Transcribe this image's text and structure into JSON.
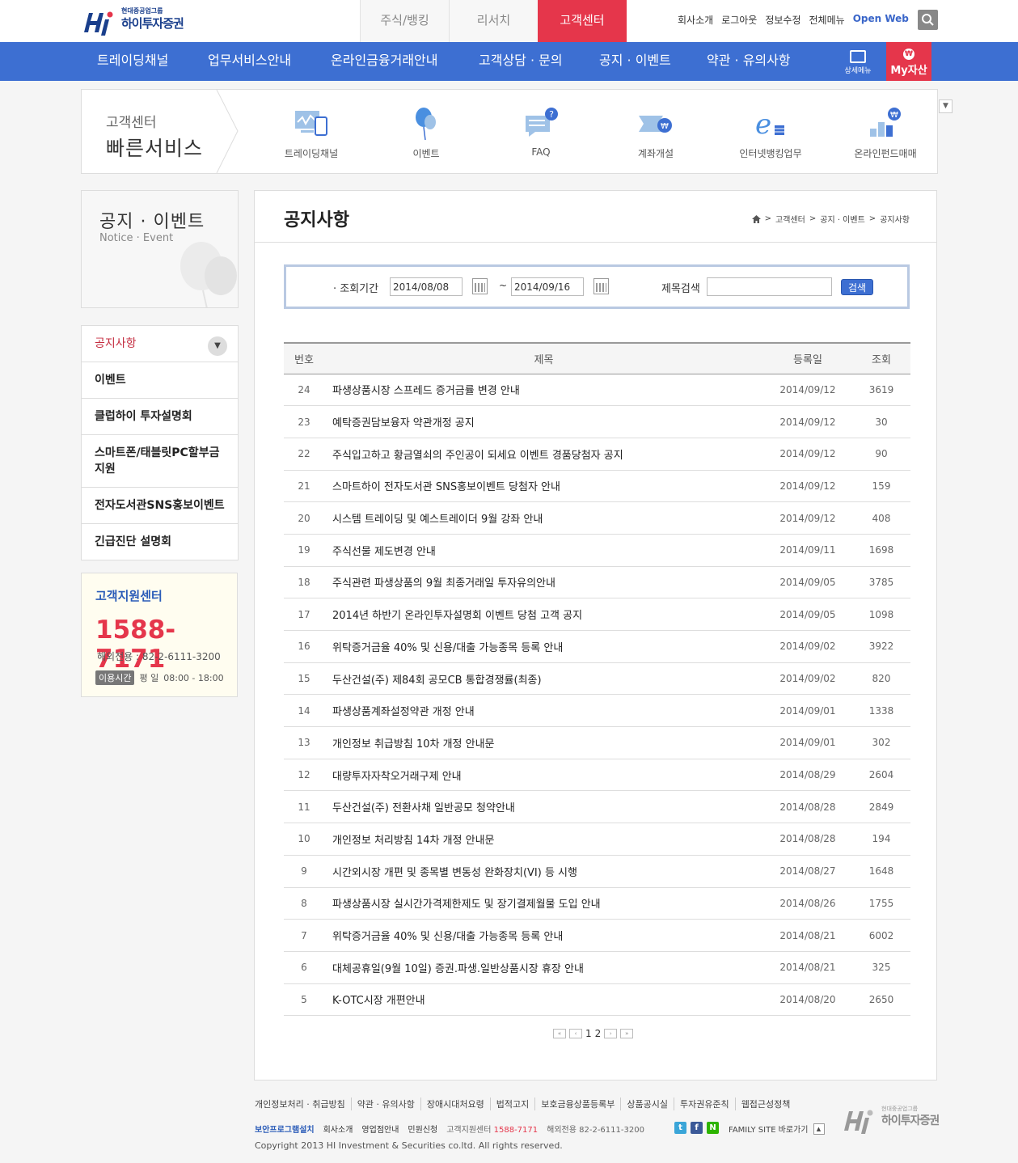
{
  "brand": {
    "group": "현대중공업그룹",
    "name": "하이투자증권"
  },
  "top_tabs": [
    {
      "label": "주식/뱅킹"
    },
    {
      "label": "리서치"
    },
    {
      "label": "고객센터"
    }
  ],
  "utility_links": [
    "회사소개",
    "로그아웃",
    "정보수정",
    "전체메뉴",
    "Open Web"
  ],
  "gnb": {
    "items": [
      "트레이딩채널",
      "업무서비스안내",
      "온라인금융거래안내",
      "고객상담 · 문의",
      "공지 · 이벤트",
      "약관 · 유의사항"
    ],
    "detail_label": "상세메뉴",
    "my_asset_label": "My자산"
  },
  "quick": {
    "small_title": "고객센터",
    "big_title": "빠른서비스",
    "items": [
      "트레이딩채널",
      "이벤트",
      "FAQ",
      "계좌개설",
      "인터넷뱅킹업무",
      "온라인펀드매매"
    ]
  },
  "side": {
    "title_ko": "공지 · 이벤트",
    "title_en": "Notice · Event",
    "menu": [
      "공지사항",
      "이벤트",
      "클럽하이 투자설명회",
      "스마트폰/태블릿PC할부금지원",
      "전자도서관SNS홍보이벤트",
      "긴급진단 설명회"
    ]
  },
  "support": {
    "title": "고객지원센터",
    "phone": "1588-7171",
    "intl": "해외전용 : 82-2-6111-3200",
    "hours_badge": "이용시간",
    "hours_days": "평  일",
    "hours": "08:00 - 18:00"
  },
  "main": {
    "title": "공지사항",
    "breadcrumb": [
      "고객센터",
      "공지 · 이벤트",
      "공지사항"
    ]
  },
  "filter": {
    "period_label": "· 조회기간",
    "start_date": "2014/08/08",
    "separator": "~",
    "end_date": "2014/09/16",
    "title_search_label": "제목검색",
    "title_search_value": "",
    "search_button": "검색"
  },
  "table": {
    "headers": [
      "번호",
      "제목",
      "등록일",
      "조회"
    ],
    "rows": [
      {
        "no": "24",
        "title": "파생상품시장 스프레드 증거금률 변경 안내",
        "date": "2014/09/12",
        "views": "3619"
      },
      {
        "no": "23",
        "title": "예탁증권담보융자 약관개정 공지",
        "date": "2014/09/12",
        "views": "30"
      },
      {
        "no": "22",
        "title": "주식입고하고 황금열쇠의 주인공이 되세요 이벤트 경품당첨자 공지",
        "date": "2014/09/12",
        "views": "90"
      },
      {
        "no": "21",
        "title": "스마트하이 전자도서관 SNS홍보이벤트 당첨자 안내",
        "date": "2014/09/12",
        "views": "159"
      },
      {
        "no": "20",
        "title": "시스템 트레이딩 및 예스트레이더 9월 강좌 안내",
        "date": "2014/09/12",
        "views": "408"
      },
      {
        "no": "19",
        "title": "주식선물 제도변경 안내",
        "date": "2014/09/11",
        "views": "1698"
      },
      {
        "no": "18",
        "title": "주식관련 파생상품의 9월 최종거래일 투자유의안내",
        "date": "2014/09/05",
        "views": "3785"
      },
      {
        "no": "17",
        "title": "2014년 하반기 온라인투자설명회 이벤트 당첨 고객 공지",
        "date": "2014/09/05",
        "views": "1098"
      },
      {
        "no": "16",
        "title": "위탁증거금율 40% 및 신용/대출 가능종목 등록 안내",
        "date": "2014/09/02",
        "views": "3922"
      },
      {
        "no": "15",
        "title": "두산건설(주) 제84회 공모CB 통합경쟁률(최종)",
        "date": "2014/09/02",
        "views": "820"
      },
      {
        "no": "14",
        "title": "파생상품계좌설정약관 개정 안내",
        "date": "2014/09/01",
        "views": "1338"
      },
      {
        "no": "13",
        "title": "개인정보 취급방침 10차 개정 안내문",
        "date": "2014/09/01",
        "views": "302"
      },
      {
        "no": "12",
        "title": "대량투자자착오거래구제 안내",
        "date": "2014/08/29",
        "views": "2604"
      },
      {
        "no": "11",
        "title": "두산건설(주) 전환사채 일반공모 청약안내",
        "date": "2014/08/28",
        "views": "2849"
      },
      {
        "no": "10",
        "title": "개인정보 처리방침 14차 개정 안내문",
        "date": "2014/08/28",
        "views": "194"
      },
      {
        "no": "9",
        "title": "시간외시장 개편 및 종목별 변동성 완화장치(VI) 등 시행",
        "date": "2014/08/27",
        "views": "1648"
      },
      {
        "no": "8",
        "title": "파생상품시장 실시간가격제한제도 및 장기결제월물 도입 안내",
        "date": "2014/08/26",
        "views": "1755"
      },
      {
        "no": "7",
        "title": "위탁증거금율 40% 및 신용/대출 가능종목 등록 안내",
        "date": "2014/08/21",
        "views": "6002"
      },
      {
        "no": "6",
        "title": "대체공휴일(9월 10일) 증권.파생.일반상품시장 휴장 안내",
        "date": "2014/08/21",
        "views": "325"
      },
      {
        "no": "5",
        "title": "K-OTC시장 개편안내",
        "date": "2014/08/20",
        "views": "2650"
      }
    ]
  },
  "pager": {
    "first": "«",
    "prev": "‹",
    "pages": [
      "1",
      "2"
    ],
    "next": "›",
    "last": "»"
  },
  "footer": {
    "links": [
      "개인정보처리 · 취급방침",
      "약관 · 유의사항",
      "장애시대처요령",
      "법적고지",
      "보호금융상품등록부",
      "상품공시실",
      "투자권유준칙",
      "웹접근성정책"
    ],
    "security": "보안프로그램설치",
    "links2": [
      "회사소개",
      "영업점안내",
      "민원신청"
    ],
    "support_label": "고객지원센터",
    "support_phone": "1588-7171",
    "intl": "해외전용 82-2-6111-3200",
    "family": "FAMILY SITE 바로가기",
    "copyright": "Copyright 2013 HI Investment & Securities co.ltd. All rights reserved."
  },
  "colors": {
    "primary_blue": "#3d6fd2",
    "accent_red": "#e5364b"
  }
}
